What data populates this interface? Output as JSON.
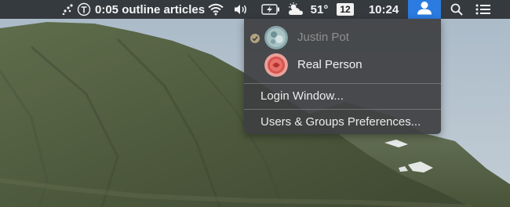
{
  "menubar": {
    "app_timer": "0:05 outline articles",
    "temperature": "51°",
    "date_badge": "12",
    "clock": "10:24"
  },
  "user_menu": {
    "users": [
      {
        "name": "Justin Pot",
        "current": true
      },
      {
        "name": "Real Person",
        "current": false
      }
    ],
    "login_window_label": "Login Window...",
    "preferences_label": "Users & Groups Preferences..."
  },
  "icons": {
    "scatter": "scatter-dots-icon",
    "timer_app": "timing-app-icon",
    "wifi": "wifi-icon",
    "volume": "volume-icon",
    "battery": "battery-charging-icon",
    "weather": "partly-cloudy-icon",
    "user": "user-icon",
    "search": "spotlight-search-icon",
    "notifications": "notification-center-icon"
  },
  "colors": {
    "accent": "#2b7be0",
    "menubar_text": "#f2f2f2",
    "dimmed_user_text": "#8f8f8f"
  }
}
